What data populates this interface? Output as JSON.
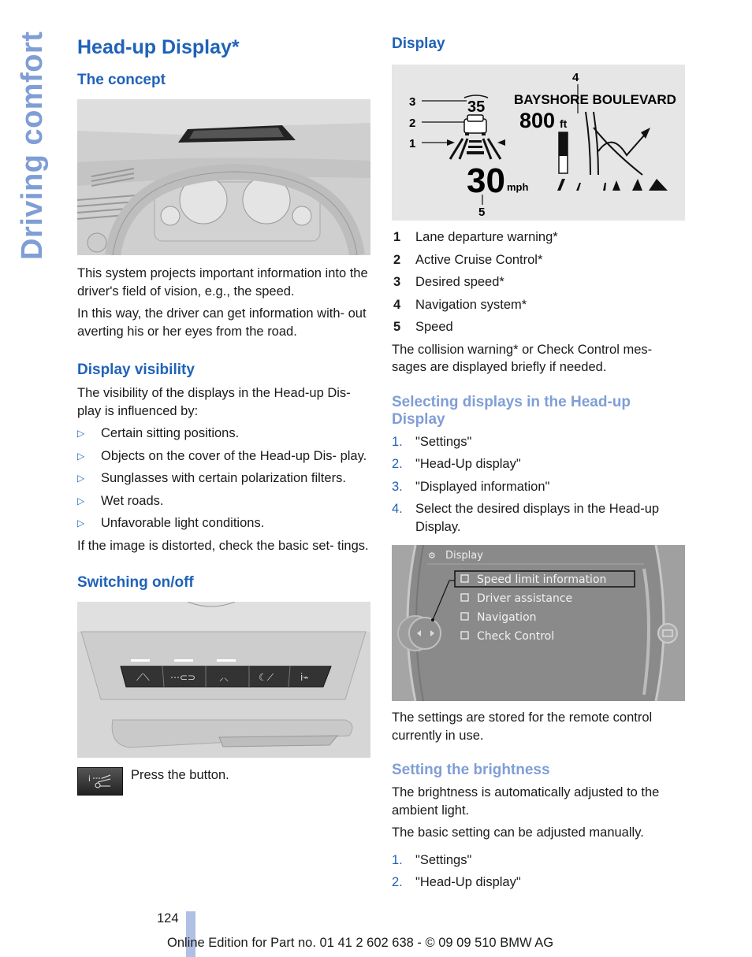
{
  "side_title": "Driving comfort",
  "left": {
    "title": "Head-up Display*",
    "concept": {
      "heading": "The concept",
      "figure_alt": "dashboard-with-head-up-display",
      "paragraphs": [
        "This system projects important information into the driver's field of vision, e.g., the speed.",
        "In this way, the driver can get information with- out averting his or her eyes from the road."
      ]
    },
    "visibility": {
      "heading": "Display visibility",
      "intro": "The visibility of the displays in the Head-up Dis- play is influenced by:",
      "bullet_marker": "▷",
      "bullets": [
        "Certain sitting positions.",
        "Objects on the cover of the Head-up Dis- play.",
        "Sunglasses with certain polarization filters.",
        "Wet roads.",
        "Unfavorable light conditions."
      ],
      "note": "If the image is distorted, check the basic set- tings."
    },
    "switching": {
      "heading": "Switching on/off",
      "figure_alt": "driver-assistance-button-panel",
      "press_text": "Press the button."
    }
  },
  "right": {
    "display": {
      "heading": "Display",
      "hud": {
        "street": "BAYSHORE BOULEVARD",
        "distance": "800",
        "distance_unit": "ft",
        "speed": "30",
        "speed_unit": "mph",
        "desired_speed": "35",
        "callouts": [
          "1",
          "2",
          "3",
          "4",
          "5"
        ]
      },
      "legend": [
        {
          "num": "1",
          "text": "Lane departure warning*"
        },
        {
          "num": "2",
          "text": "Active Cruise Control*"
        },
        {
          "num": "3",
          "text": "Desired speed*"
        },
        {
          "num": "4",
          "text": "Navigation system*"
        },
        {
          "num": "5",
          "text": "Speed"
        }
      ],
      "note": "The collision warning* or Check Control mes- sages are displayed briefly if needed."
    },
    "selecting": {
      "heading": "Selecting displays in the Head-up Display",
      "steps": [
        {
          "num": "1.",
          "text": "\"Settings\""
        },
        {
          "num": "2.",
          "text": "\"Head-Up display\""
        },
        {
          "num": "3.",
          "text": "\"Displayed information\""
        },
        {
          "num": "4.",
          "text": "Select the desired displays in the Head-up Display."
        }
      ],
      "screen": {
        "title": "Display",
        "items": [
          "Speed limit information",
          "Driver assistance",
          "Navigation",
          "Check Control"
        ],
        "selected_index": 0
      },
      "note": "The settings are stored for the remote control currently in use."
    },
    "brightness": {
      "heading": "Setting the brightness",
      "paragraphs": [
        "The brightness is automatically adjusted to the ambient light.",
        "The basic setting can be adjusted manually."
      ],
      "steps": [
        {
          "num": "1.",
          "text": "\"Settings\""
        },
        {
          "num": "2.",
          "text": "\"Head-Up display\""
        }
      ]
    }
  },
  "footer": {
    "page_number": "124",
    "edition": "Online Edition for Part no. 01 41 2 602 638 - © 09 09 510 BMW AG"
  }
}
